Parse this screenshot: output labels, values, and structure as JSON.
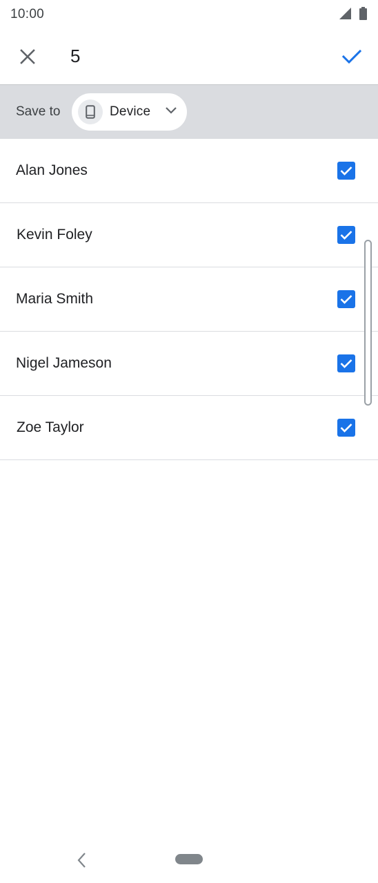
{
  "status_bar": {
    "time": "10:00",
    "icons": [
      "signal-icon",
      "battery-icon"
    ]
  },
  "app_bar": {
    "close_icon": "close-icon",
    "selected_count": "5",
    "confirm_icon": "check-icon"
  },
  "save_to": {
    "label": "Save to",
    "chip_icon": "phone-icon",
    "chip_label": "Device",
    "chevron_icon": "chevron-down-icon"
  },
  "contacts": [
    {
      "name": "Alan Jones",
      "checked": true
    },
    {
      "name": "Kevin Foley",
      "checked": true
    },
    {
      "name": "Maria Smith",
      "checked": true
    },
    {
      "name": "Nigel Jameson",
      "checked": true
    },
    {
      "name": "Zoe Taylor",
      "checked": true
    }
  ],
  "nav_bar": {
    "back_icon": "back-icon",
    "home_icon": "home-pill-icon"
  },
  "colors": {
    "accent": "#1a73e8",
    "save_bar_bg": "#dadce0",
    "divider": "#dadce0"
  }
}
